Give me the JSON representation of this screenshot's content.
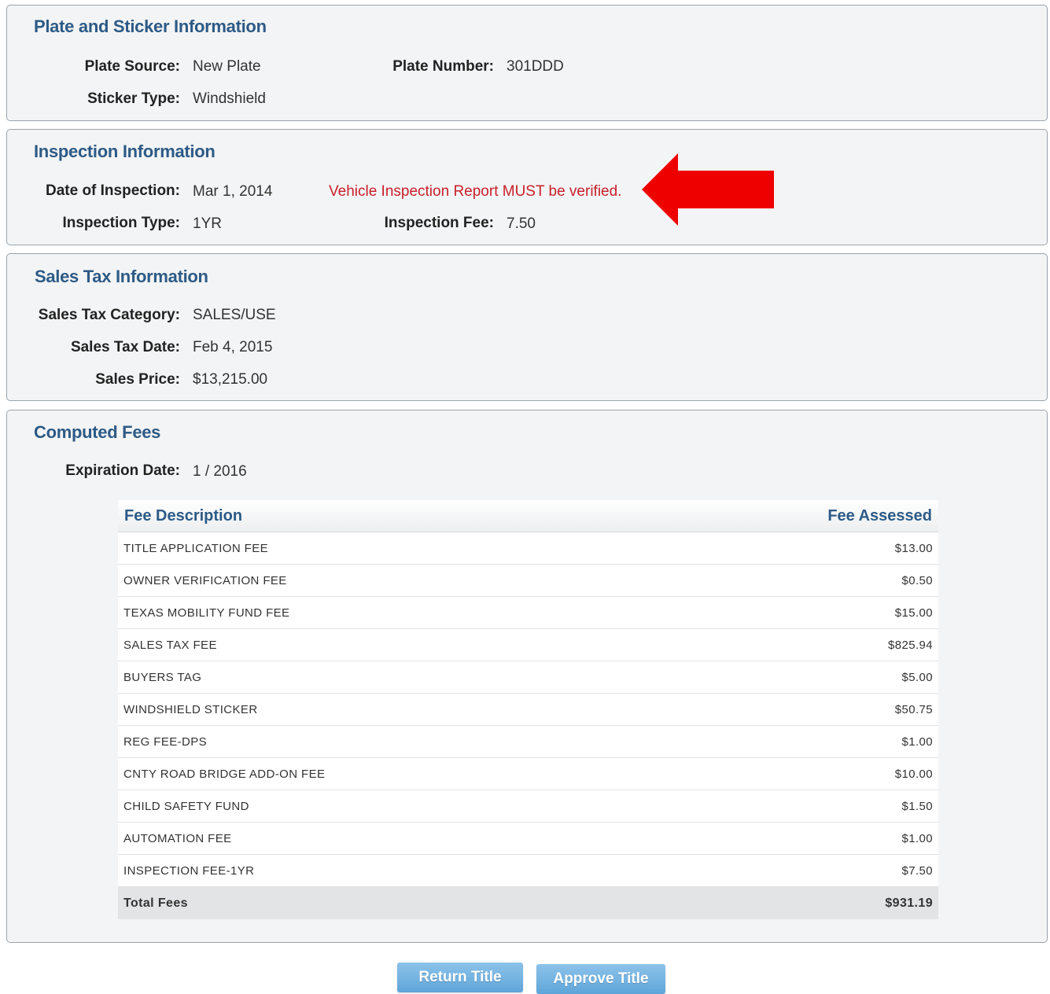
{
  "plate_panel": {
    "title": "Plate and Sticker Information",
    "plate_source_label": "Plate Source:",
    "plate_source_value": "New Plate",
    "plate_number_label": "Plate Number:",
    "plate_number_value": "301DDD",
    "sticker_type_label": "Sticker Type:",
    "sticker_type_value": "Windshield"
  },
  "inspection_panel": {
    "title": "Inspection Information",
    "date_label": "Date of Inspection:",
    "date_value": "Mar 1, 2014",
    "warning": "Vehicle Inspection Report MUST be verified.",
    "type_label": "Inspection Type:",
    "type_value": "1YR",
    "fee_label": "Inspection Fee:",
    "fee_value": "7.50"
  },
  "sales_tax_panel": {
    "title": "Sales Tax Information",
    "category_label": "Sales Tax Category:",
    "category_value": "SALES/USE",
    "date_label": "Sales Tax Date:",
    "date_value": "Feb 4, 2015",
    "price_label": "Sales Price:",
    "price_value": "$13,215.00"
  },
  "fees_panel": {
    "title": "Computed Fees",
    "expiration_label": "Expiration Date:",
    "expiration_value": "1 / 2016",
    "table": {
      "col_description": "Fee Description",
      "col_assessed": "Fee Assessed",
      "rows": [
        {
          "description": "TITLE APPLICATION FEE",
          "amount": "$13.00"
        },
        {
          "description": "OWNER VERIFICATION FEE",
          "amount": "$0.50"
        },
        {
          "description": "TEXAS MOBILITY FUND FEE",
          "amount": "$15.00"
        },
        {
          "description": "SALES TAX FEE",
          "amount": "$825.94"
        },
        {
          "description": "BUYERS TAG",
          "amount": "$5.00"
        },
        {
          "description": "WINDSHIELD STICKER",
          "amount": "$50.75"
        },
        {
          "description": "REG FEE-DPS",
          "amount": "$1.00"
        },
        {
          "description": "CNTY ROAD BRIDGE ADD-ON FEE",
          "amount": "$10.00"
        },
        {
          "description": "CHILD SAFETY FUND",
          "amount": "$1.50"
        },
        {
          "description": "AUTOMATION FEE",
          "amount": "$1.00"
        },
        {
          "description": "INSPECTION FEE-1YR",
          "amount": "$7.50"
        }
      ],
      "total_label": "Total Fees",
      "total_value": "$931.19"
    }
  },
  "actions": {
    "return_label": "Return Title",
    "approve_label": "Approve Title"
  },
  "colors": {
    "panel_title": "#2d5a86",
    "warning_text": "#c8202a",
    "annotation_arrow": "#ee0000",
    "button": "#6aaedd"
  },
  "icons": {
    "annotation": "red-arrow-icon"
  }
}
